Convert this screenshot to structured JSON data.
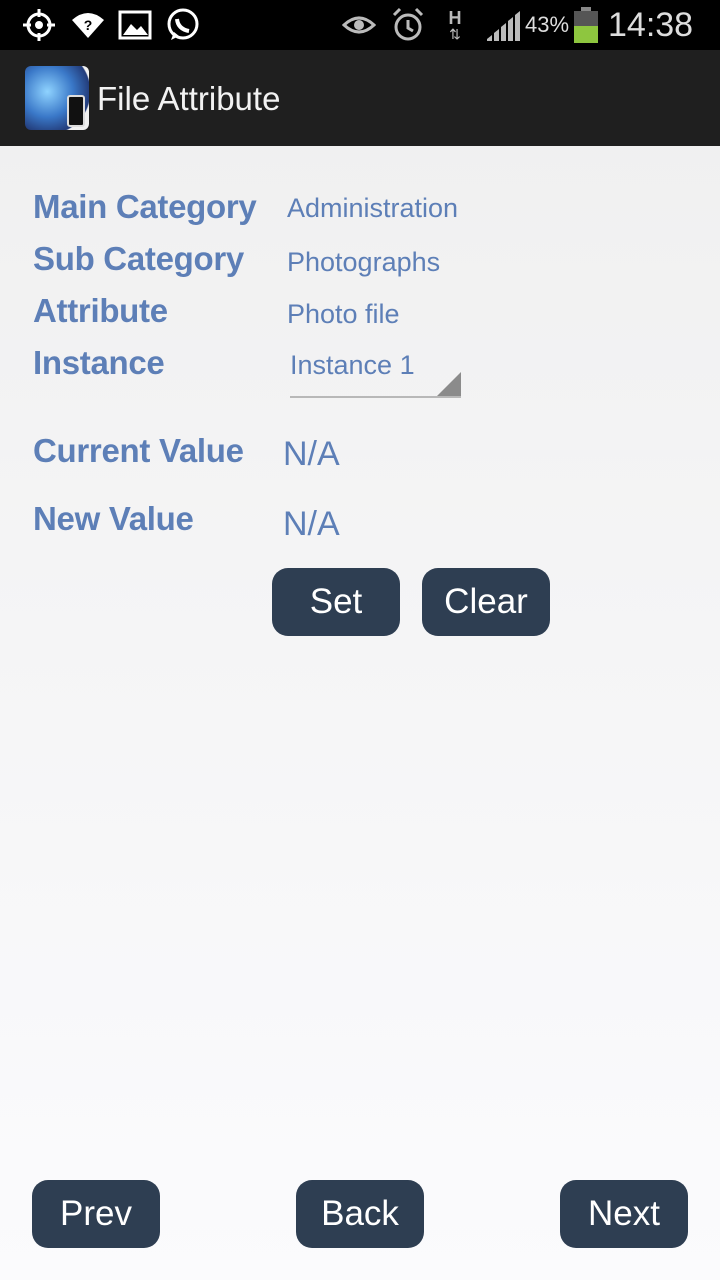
{
  "status_bar": {
    "battery_percent": "43%",
    "time": "14:38",
    "network_type": "H",
    "icons": [
      "gps-icon",
      "wifi-icon",
      "image-icon",
      "whatsapp-icon",
      "eye-icon",
      "alarm-icon",
      "signal-icon",
      "battery-icon"
    ]
  },
  "action_bar": {
    "title": "File Attribute",
    "app_icon": "globe-phone-icon"
  },
  "form": {
    "main_category_label": "Main Category",
    "main_category_value": "Administration",
    "sub_category_label": "Sub Category",
    "sub_category_value": "Photographs",
    "attribute_label": "Attribute",
    "attribute_value": "Photo file",
    "instance_label": "Instance",
    "instance_selected": "Instance 1",
    "current_value_label": "Current Value",
    "current_value": "N/A",
    "new_value_label": "New Value",
    "new_value": "N/A",
    "set_label": "Set",
    "clear_label": "Clear"
  },
  "nav": {
    "prev_label": "Prev",
    "back_label": "Back",
    "next_label": "Next"
  },
  "colors": {
    "label": "#5d7fb7",
    "button": "#2e3e52",
    "action_bar": "#1f1f1f"
  }
}
